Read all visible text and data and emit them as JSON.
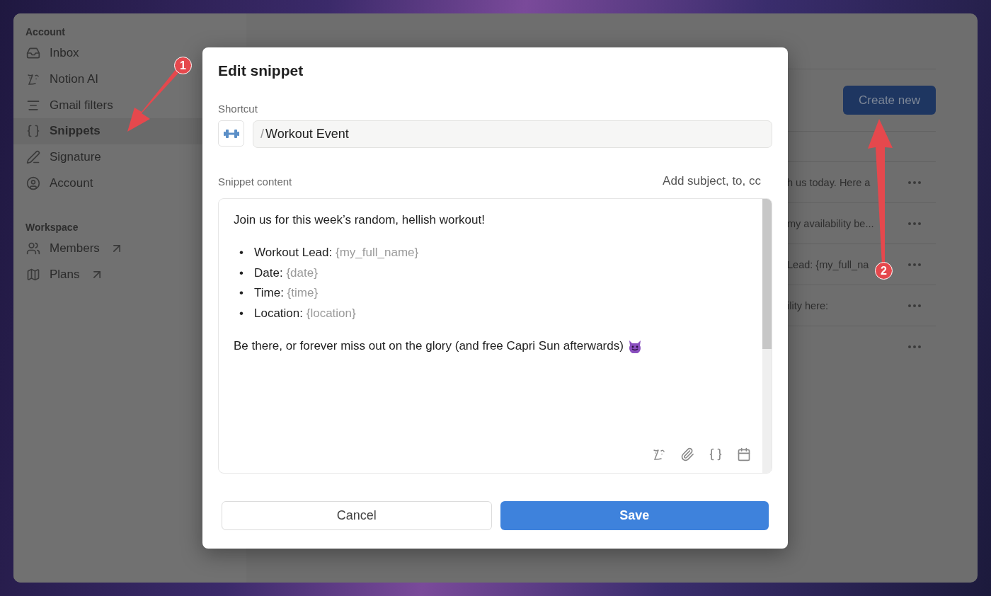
{
  "sidebar": {
    "sections": [
      {
        "title": "Account",
        "items": [
          {
            "label": "Inbox",
            "selected": false,
            "external": false
          },
          {
            "label": "Notion AI",
            "selected": false,
            "external": false
          },
          {
            "label": "Gmail filters",
            "selected": false,
            "external": false
          },
          {
            "label": "Snippets",
            "selected": true,
            "external": false
          },
          {
            "label": "Signature",
            "selected": false,
            "external": false
          },
          {
            "label": "Account",
            "selected": false,
            "external": false
          }
        ]
      },
      {
        "title": "Workspace",
        "items": [
          {
            "label": "Members",
            "selected": false,
            "external": true
          },
          {
            "label": "Plans",
            "selected": false,
            "external": true
          }
        ]
      }
    ]
  },
  "main": {
    "create_button": "Create new",
    "rows": [
      {
        "text": "h us today. Here a"
      },
      {
        "text": " my availability be..."
      },
      {
        "text": "Lead: {my_full_na"
      },
      {
        "text": "ility here:"
      },
      {
        "text": ""
      }
    ]
  },
  "modal": {
    "title": "Edit snippet",
    "shortcut_label": "Shortcut",
    "shortcut_prefix": "/",
    "shortcut_value": "Workout Event",
    "content_label": "Snippet content",
    "add_fields_link": "Add subject, to, cc",
    "blocks": [
      {
        "kind": "paragraph",
        "text": "Join us for this week’s random, hellish workout!",
        "emoji": false
      },
      {
        "kind": "list",
        "items": [
          {
            "marker": "•",
            "label": "Workout Lead:",
            "variable": "{my_full_name}"
          },
          {
            "marker": "•",
            "label": "Date:",
            "variable": "{date}"
          },
          {
            "marker": "•",
            "label": "Time:",
            "variable": "{time}"
          },
          {
            "marker": "•",
            "label": "Location:",
            "variable": "{location}"
          }
        ]
      },
      {
        "kind": "paragraph",
        "text": "Be there, or forever miss out on the glory (and free Capri Sun afterwards)",
        "emoji": true
      }
    ],
    "cancel": "Cancel",
    "save": "Save"
  },
  "annotations": [
    {
      "label": "1"
    },
    {
      "label": "2"
    }
  ]
}
